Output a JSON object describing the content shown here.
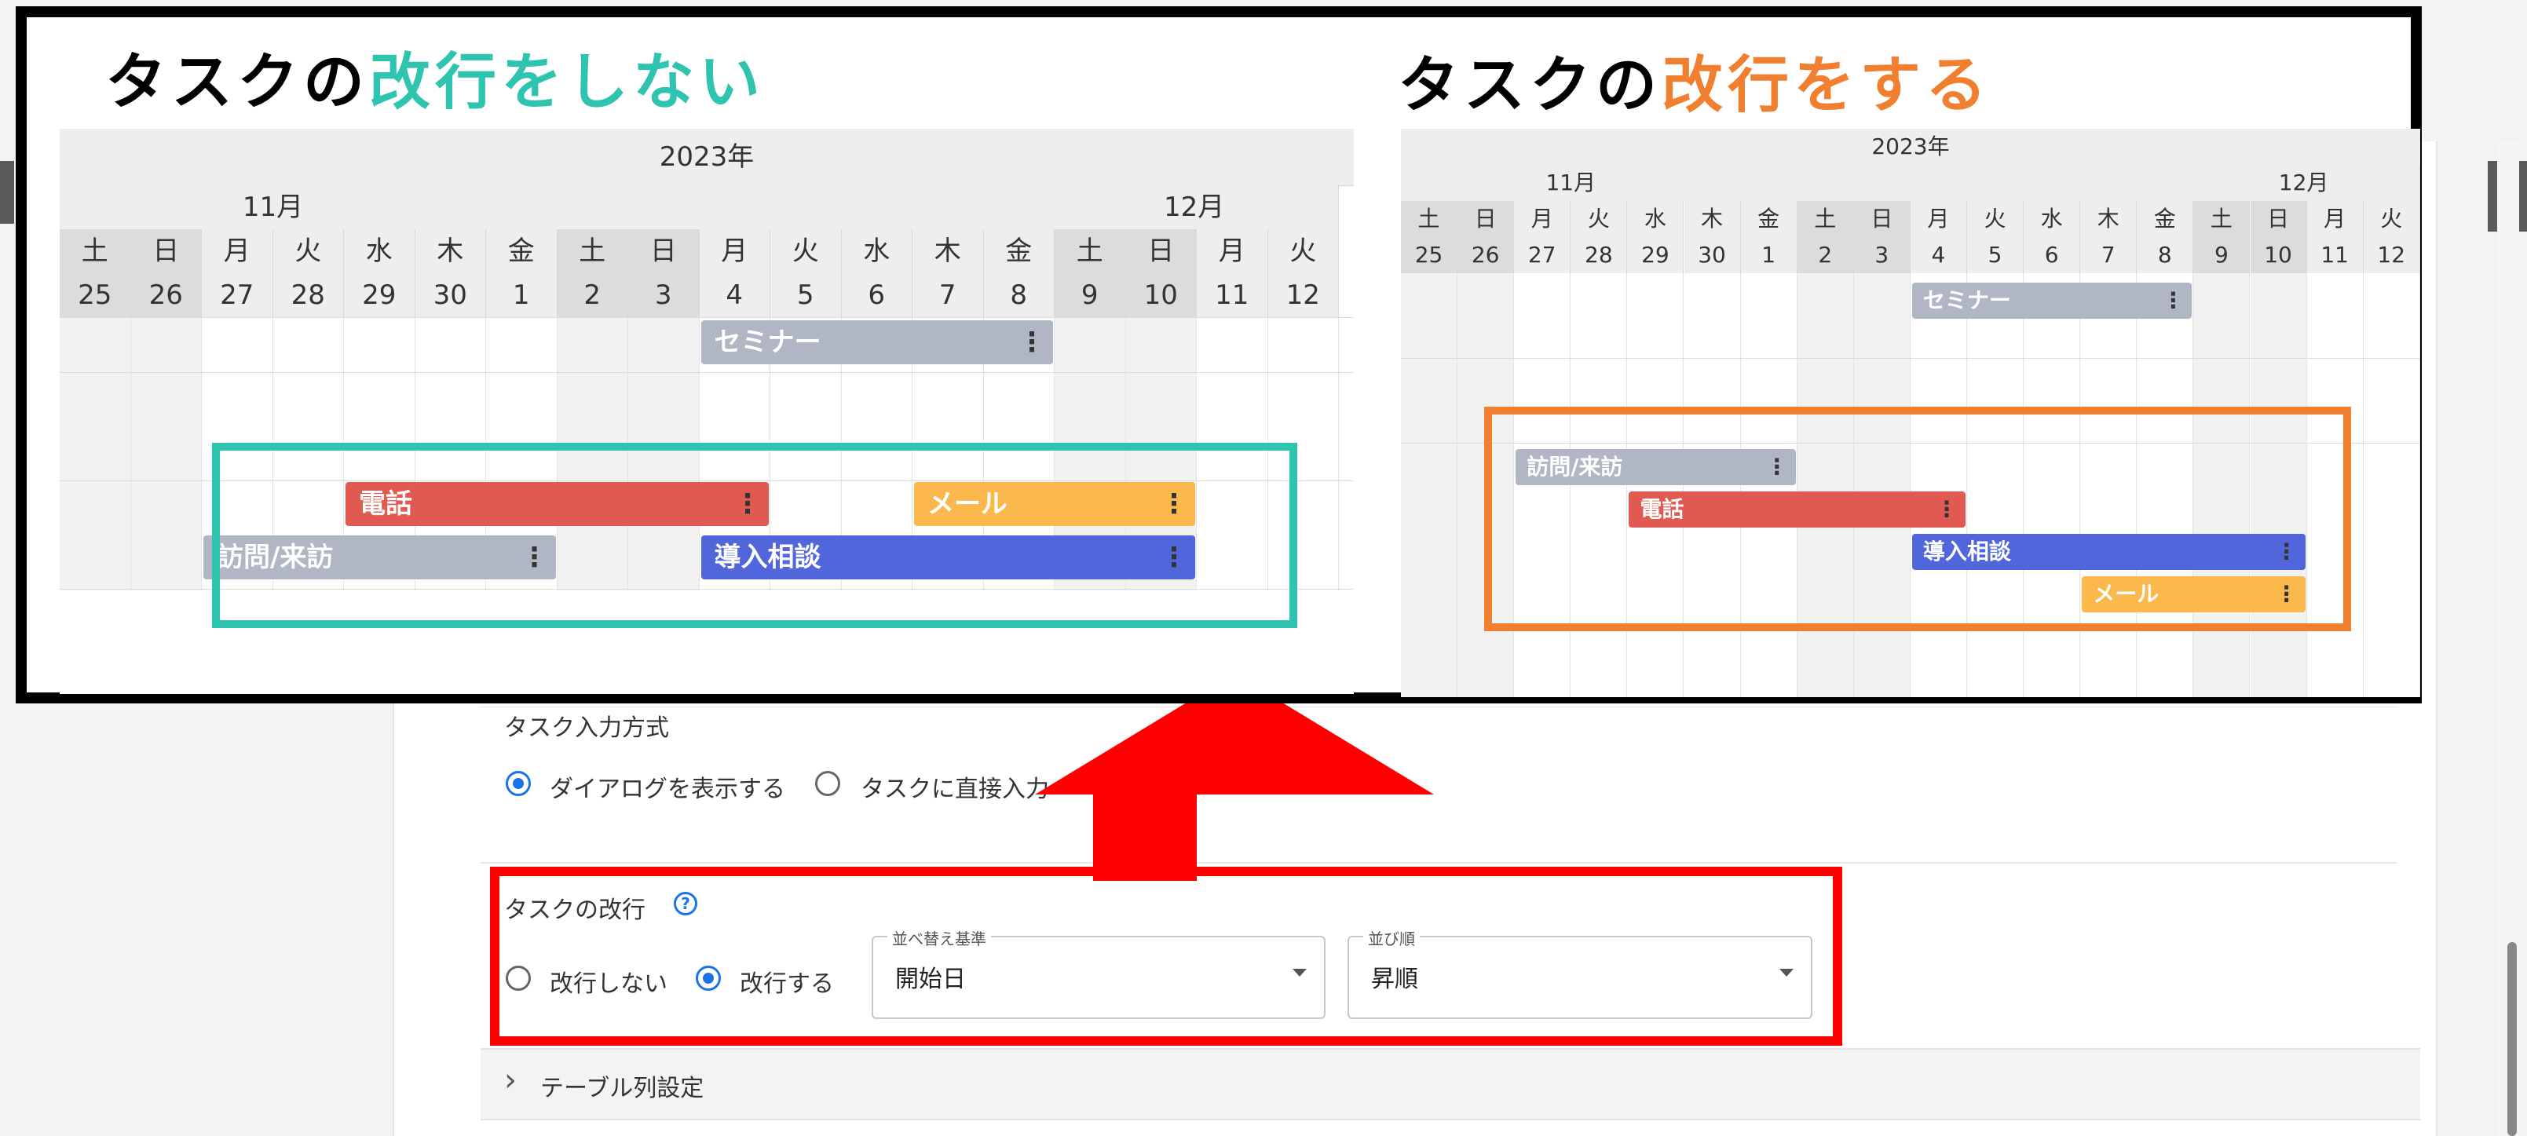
{
  "annotation": {
    "left_title_prefix": "タスクの",
    "left_title_highlight": "改行をしない",
    "right_title_prefix": "タスクの",
    "right_title_highlight": "改行をする",
    "colors": {
      "teal": "#2ec4b0",
      "orange": "#f08030",
      "red": "#ff0000"
    }
  },
  "gantt": {
    "year": "2023年",
    "month_nov": "11月",
    "month_dec": "12月",
    "days": [
      {
        "dow": "土",
        "date": "25",
        "weekend": true
      },
      {
        "dow": "日",
        "date": "26",
        "weekend": true
      },
      {
        "dow": "月",
        "date": "27",
        "weekend": false
      },
      {
        "dow": "火",
        "date": "28",
        "weekend": false
      },
      {
        "dow": "水",
        "date": "29",
        "weekend": false
      },
      {
        "dow": "木",
        "date": "30",
        "weekend": false
      },
      {
        "dow": "金",
        "date": "1",
        "weekend": false
      },
      {
        "dow": "土",
        "date": "2",
        "weekend": true
      },
      {
        "dow": "日",
        "date": "3",
        "weekend": true
      },
      {
        "dow": "月",
        "date": "4",
        "weekend": false
      },
      {
        "dow": "火",
        "date": "5",
        "weekend": false
      },
      {
        "dow": "水",
        "date": "6",
        "weekend": false
      },
      {
        "dow": "木",
        "date": "7",
        "weekend": false
      },
      {
        "dow": "金",
        "date": "8",
        "weekend": false
      },
      {
        "dow": "土",
        "date": "9",
        "weekend": true
      },
      {
        "dow": "日",
        "date": "10",
        "weekend": true
      },
      {
        "dow": "月",
        "date": "11",
        "weekend": false
      },
      {
        "dow": "火",
        "date": "12",
        "weekend": false
      }
    ],
    "tasks": {
      "seminar": "セミナー",
      "phone": "電話",
      "mail": "メール",
      "visit": "訪問/来訪",
      "consult": "導入相談"
    },
    "task_colors": {
      "seminar": "#b0b6c4",
      "phone": "#e05a52",
      "mail": "#fbb84c",
      "visit": "#b0b6c4",
      "consult": "#5266db"
    },
    "menu_glyph": "⋮"
  },
  "settings": {
    "input_method_label": "タスク入力方式",
    "input_option_dialog": "ダイアログを表示する",
    "input_option_direct": "タスクに直接入力",
    "wrap_label": "タスクの改行",
    "help_glyph": "?",
    "wrap_option_off": "改行しない",
    "wrap_option_on": "改行する",
    "sort_key_legend": "並べ替え基準",
    "sort_key_value": "開始日",
    "sort_order_legend": "並び順",
    "sort_order_value": "昇順",
    "table_columns_label": "テーブル列設定",
    "expand_glyph": "›"
  },
  "page": {
    "search_glyph": "⌕"
  }
}
